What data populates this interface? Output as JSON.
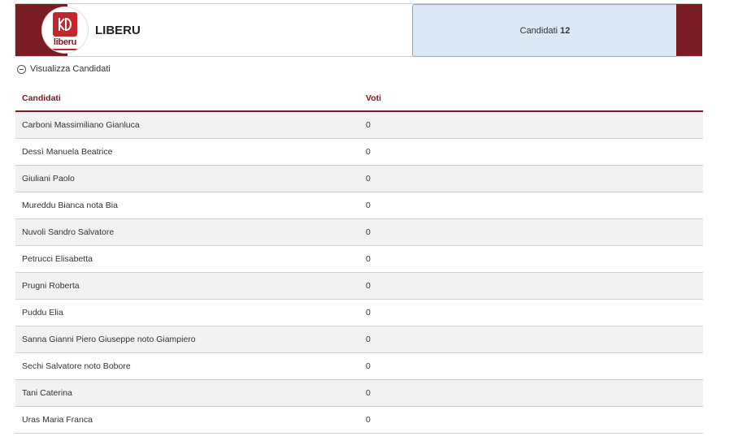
{
  "list": {
    "logo_text": "liberu",
    "name": "LIBERU",
    "candidates_label": "Candidati",
    "candidates_count": "12",
    "brand_color": "#7a1c24",
    "count_box_color": "#d9e8f4"
  },
  "toggle": {
    "label": "Visualizza Candidati",
    "icon": "minus-circle-icon"
  },
  "table": {
    "headers": {
      "name": "Candidati",
      "votes": "Voti"
    },
    "rows": [
      {
        "name": "Carboni Massimiliano Gianluca",
        "votes": "0"
      },
      {
        "name": "Dessì Manuela Beatrice",
        "votes": "0"
      },
      {
        "name": "Giuliani Paolo",
        "votes": "0"
      },
      {
        "name": "Mureddu Bianca nota Bia",
        "votes": "0"
      },
      {
        "name": "Nuvoli Sandro Salvatore",
        "votes": "0"
      },
      {
        "name": "Petrucci Elisabetta",
        "votes": "0"
      },
      {
        "name": "Prugni Roberta",
        "votes": "0"
      },
      {
        "name": "Puddu Elia",
        "votes": "0"
      },
      {
        "name": "Sanna Gianni Piero Giuseppe noto Giampiero",
        "votes": "0"
      },
      {
        "name": "Sechi Salvatore noto Bobore",
        "votes": "0"
      },
      {
        "name": "Tani Caterina",
        "votes": "0"
      },
      {
        "name": "Uras Maria Franca",
        "votes": "0"
      }
    ]
  }
}
